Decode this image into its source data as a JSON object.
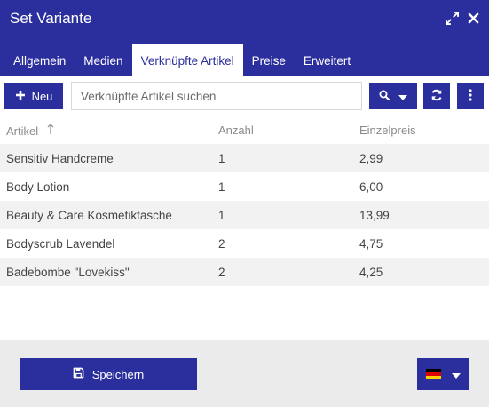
{
  "window": {
    "title": "Set Variante"
  },
  "tabs": [
    {
      "label": "Allgemein",
      "active": false
    },
    {
      "label": "Medien",
      "active": false
    },
    {
      "label": "Verknüpfte Artikel",
      "active": true
    },
    {
      "label": "Preise",
      "active": false
    },
    {
      "label": "Erweitert",
      "active": false
    }
  ],
  "toolbar": {
    "new_label": "Neu",
    "search_placeholder": "Verknüpfte Artikel suchen"
  },
  "table": {
    "headers": {
      "artikel": "Artikel",
      "anzahl": "Anzahl",
      "preis": "Einzelpreis"
    },
    "sort": {
      "column": "artikel",
      "direction": "ascending"
    },
    "rows": [
      {
        "artikel": "Sensitiv Handcreme",
        "anzahl": "1",
        "preis": "2,99"
      },
      {
        "artikel": "Body Lotion",
        "anzahl": "1",
        "preis": "6,00"
      },
      {
        "artikel": "Beauty & Care Kosmetiktasche",
        "anzahl": "1",
        "preis": "13,99"
      },
      {
        "artikel": "Bodyscrub Lavendel",
        "anzahl": "2",
        "preis": "4,75"
      },
      {
        "artikel": "Badebombe \"Lovekiss\"",
        "anzahl": "2",
        "preis": "4,25"
      }
    ]
  },
  "footer": {
    "save_label": "Speichern",
    "language": "de"
  },
  "icons": {
    "expand": "expand-icon",
    "close": "close-icon",
    "plus": "plus-icon",
    "search": "search-icon",
    "caret": "caret-down-icon",
    "refresh": "refresh-icon",
    "more": "more-vertical-icon",
    "sort": "sort-asc-icon",
    "save": "save-icon",
    "flag": "flag-germany-icon"
  },
  "colors": {
    "primary": "#2b2f9e",
    "row_stripe": "#f2f2f2",
    "footer_bg": "#ebebeb"
  }
}
